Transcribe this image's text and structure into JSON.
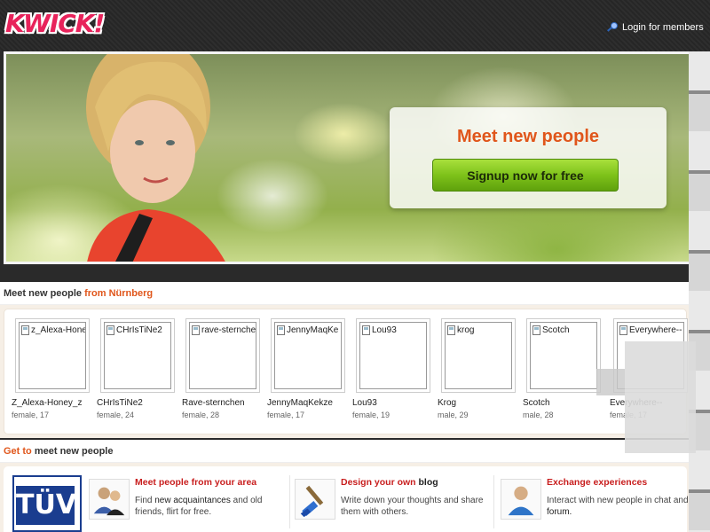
{
  "header": {
    "logo_text": "KWICK!",
    "login_label": "Login for members"
  },
  "hero": {
    "title": "Meet new people",
    "signup_label": "Signup now for free"
  },
  "meet_section": {
    "heading_prefix": "Meet new people",
    "heading_location": "from Nürnberg",
    "people": [
      {
        "thumb_alt": "z_Alexa-Hone",
        "name": "Z_Alexa-Honey_z",
        "meta": "female, 17"
      },
      {
        "thumb_alt": "CHrIsTiNe2",
        "name": "CHrIsTiNe2",
        "meta": "female, 24"
      },
      {
        "thumb_alt": "rave-sternche",
        "name": "Rave-sternchen",
        "meta": "female, 28"
      },
      {
        "thumb_alt": "JennyMaqKe",
        "name": "JennyMaqKekze",
        "meta": "female, 17"
      },
      {
        "thumb_alt": "Lou93",
        "name": "Lou93",
        "meta": "female, 19"
      },
      {
        "thumb_alt": "krog",
        "name": "Krog",
        "meta": "male, 29"
      },
      {
        "thumb_alt": "Scotch",
        "name": "Scotch",
        "meta": "male, 28"
      },
      {
        "thumb_alt": "Everywhere--",
        "name": "Everywhere--",
        "meta": "female, 17"
      }
    ]
  },
  "get_section": {
    "heading_prefix": "Get to",
    "heading_rest": "meet new people"
  },
  "badge": {
    "text": "TÜV"
  },
  "features": [
    {
      "title": "Meet people from your area",
      "title_dark": "",
      "desc_a": "Find",
      "desc_b": "new acquaintances",
      "desc_c": "and old friends, flirt for free.",
      "icon": "people-icon"
    },
    {
      "title": "Design your own",
      "title_dark": "blog",
      "desc_a": "Write down your thoughts and share them with others.",
      "desc_b": "",
      "desc_c": "",
      "icon": "paintbrush-icon"
    },
    {
      "title": "Exchange experiences",
      "title_dark": "",
      "desc_a": "Interact with new people in chat and",
      "desc_b": "forum.",
      "desc_c": "",
      "icon": "person-icon"
    }
  ],
  "colors": {
    "accent": "#e0561b",
    "feature_title": "#c81e1e",
    "signup_green": "#7ec21a"
  }
}
